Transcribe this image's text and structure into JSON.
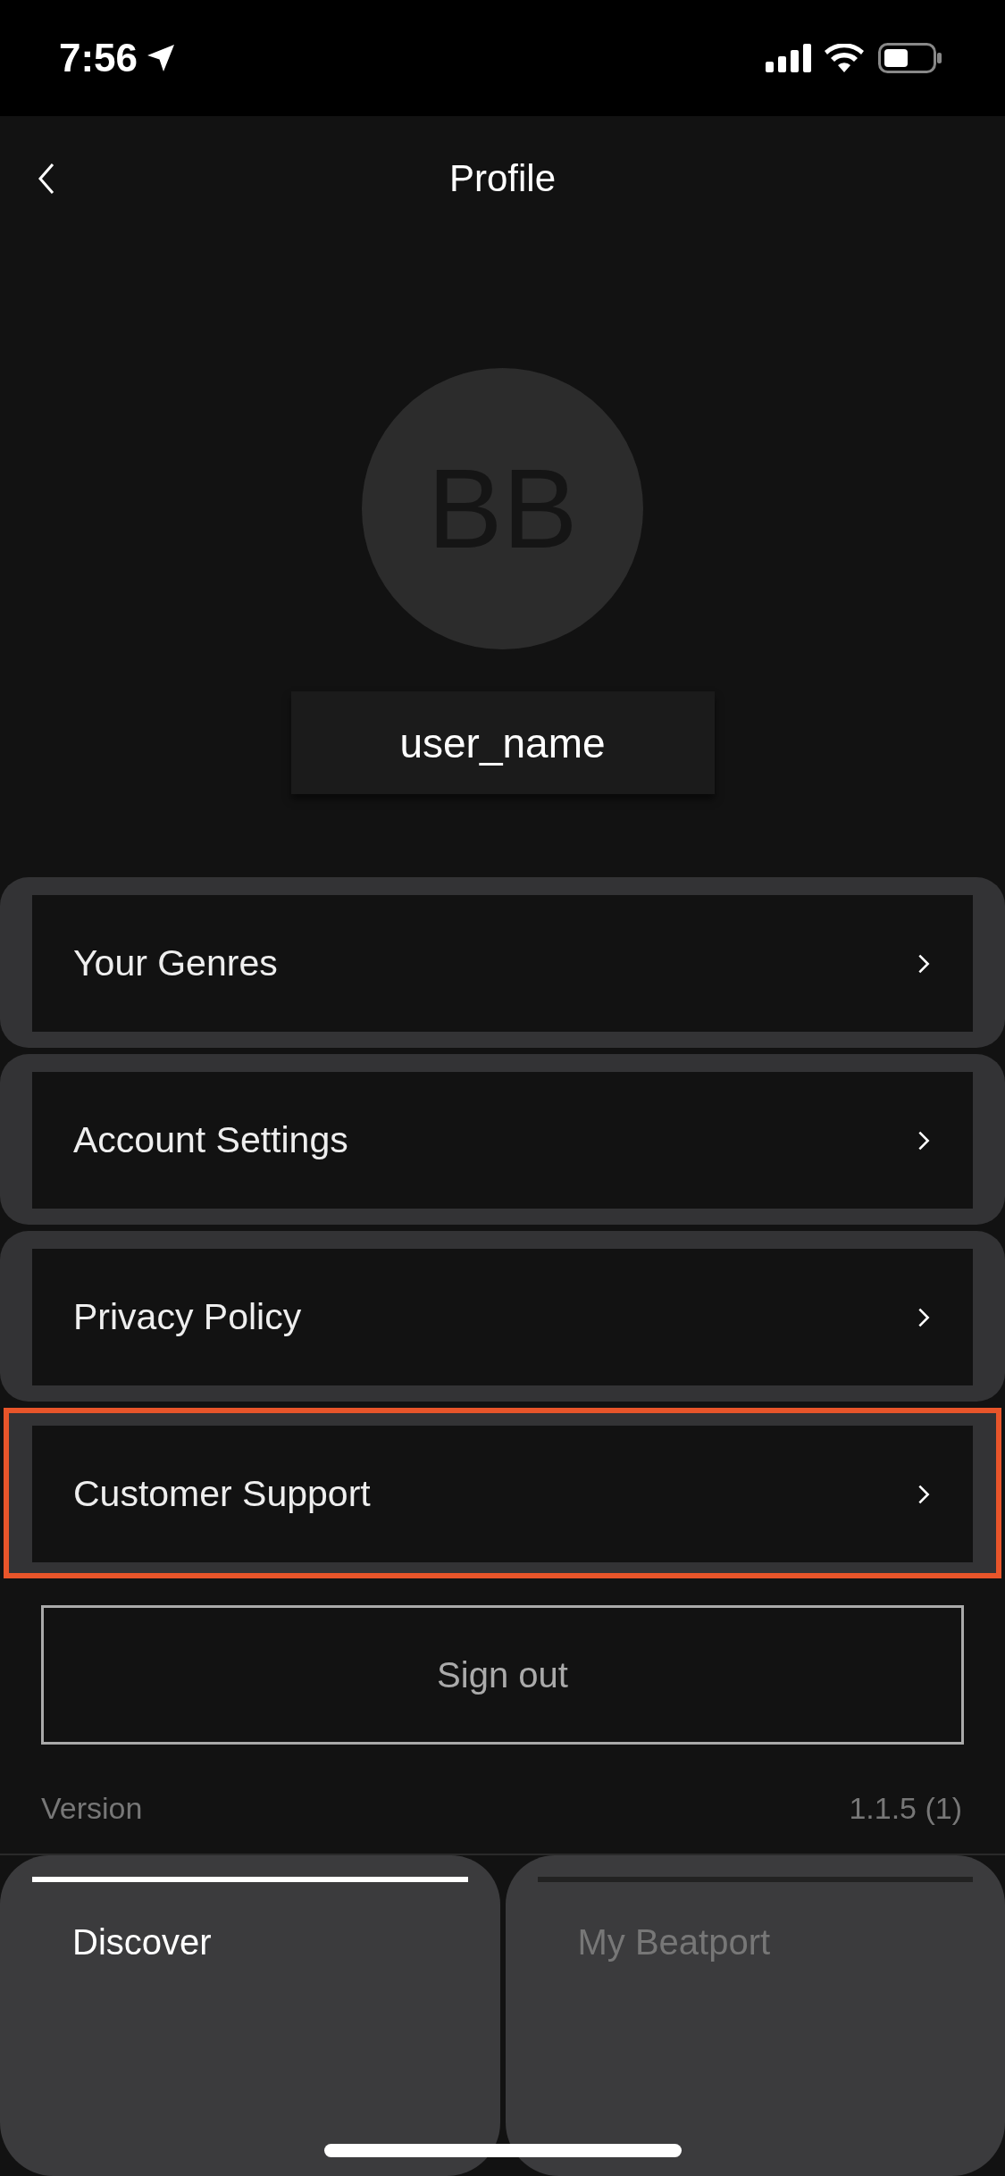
{
  "status_bar": {
    "time": "7:56"
  },
  "header": {
    "title": "Profile"
  },
  "profile": {
    "initials": "BB",
    "username": "user_name"
  },
  "menu": [
    {
      "label": "Your Genres",
      "highlighted": false
    },
    {
      "label": "Account Settings",
      "highlighted": false
    },
    {
      "label": "Privacy Policy",
      "highlighted": false
    },
    {
      "label": "Customer Support",
      "highlighted": true
    }
  ],
  "sign_out": "Sign out",
  "version": {
    "label": "Version",
    "value": "1.1.5 (1)"
  },
  "tabs": [
    {
      "label": "Discover",
      "selected": true
    },
    {
      "label": "My Beatport",
      "selected": false
    }
  ]
}
